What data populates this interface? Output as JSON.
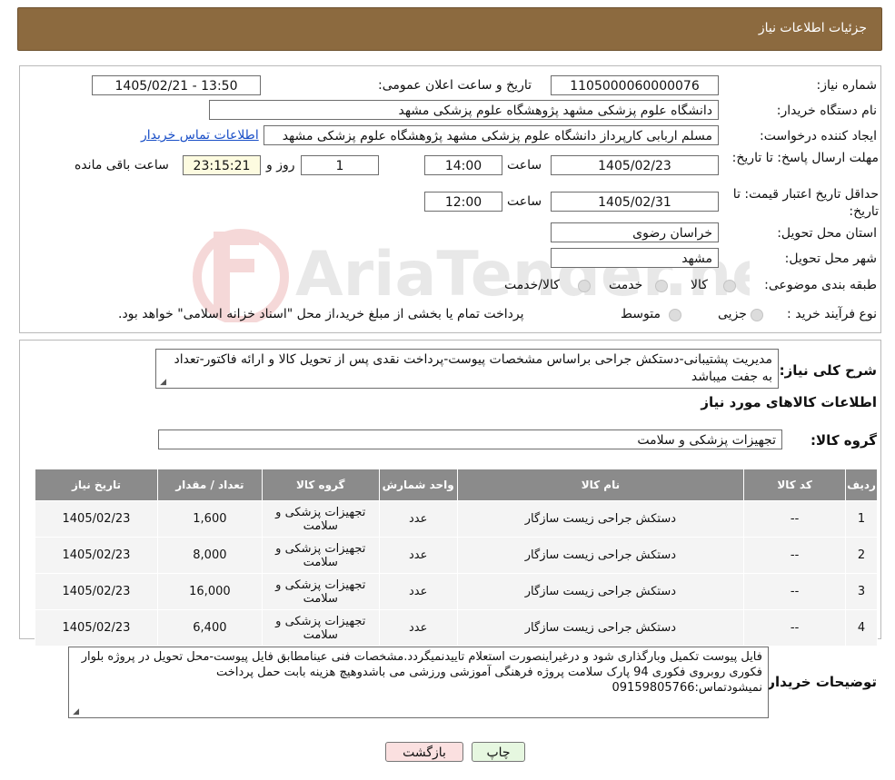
{
  "header": {
    "title": "جزئیات اطلاعات نیاز"
  },
  "form": {
    "need_number_label": "شماره نیاز:",
    "need_number": "1105000060000076",
    "announce_label": "تاریخ و ساعت اعلان عمومی:",
    "announce_value": "1405/02/21 - 13:50",
    "buyer_org_label": "نام دستگاه خریدار:",
    "buyer_org": "دانشگاه علوم پزشکی مشهد   پژوهشگاه علوم پزشکی مشهد",
    "creator_label": "ایجاد کننده درخواست:",
    "creator": "مسلم اربابی کارپرداز دانشگاه علوم پزشکی مشهد   پژوهشگاه علوم پزشکی مشهد",
    "contact_link": "اطلاعات تماس خریدار",
    "deadline_label": "مهلت ارسال پاسخ: تا تاریخ:",
    "deadline_date": "1405/02/23",
    "time_label": "ساعت",
    "deadline_time": "14:00",
    "days_value": "1",
    "days_label": "روز و",
    "remaining_time": "23:15:21",
    "remaining_label": "ساعت باقی مانده",
    "validity_label": "حداقل تاریخ اعتبار قیمت: تا تاریخ:",
    "validity_date": "1405/02/31",
    "validity_time": "12:00",
    "province_label": "استان محل تحویل:",
    "province": "خراسان رضوی",
    "city_label": "شهر محل تحویل:",
    "city": "مشهد",
    "category_label": "طبقه بندی موضوعی:",
    "category_options": [
      "کالا",
      "خدمت",
      "کالا/خدمت"
    ],
    "process_label": "نوع فرآیند خرید :",
    "process_options": [
      "جزیی",
      "متوسط"
    ],
    "process_note": "پرداخت تمام یا بخشی از مبلغ خرید،از محل \"اسناد خزانه اسلامی\" خواهد بود."
  },
  "description": {
    "label": "شرح کلی نیاز:",
    "text": "مدیریت پشتیبانی-دستکش جراحی براساس مشخصات پیوست-پرداخت نقدی پس از تحویل کالا و ارائه فاکتور-تعداد به جفت میباشد"
  },
  "goods_section": {
    "title": "اطلاعات کالاهای مورد نیاز",
    "group_label": "گروه کالا:",
    "group_value": "تجهیزات پزشکی و سلامت"
  },
  "table": {
    "headers": [
      "ردیف",
      "کد کالا",
      "نام کالا",
      "واحد شمارش",
      "گروه کالا",
      "تعداد / مقدار",
      "تاریخ نیاز"
    ],
    "rows": [
      [
        "1",
        "--",
        "دستکش جراحی زیست سازگار",
        "عدد",
        "تجهیزات پزشکی و سلامت",
        "1,600",
        "1405/02/23"
      ],
      [
        "2",
        "--",
        "دستکش جراحی زیست سازگار",
        "عدد",
        "تجهیزات پزشکی و سلامت",
        "8,000",
        "1405/02/23"
      ],
      [
        "3",
        "--",
        "دستکش جراحی زیست سازگار",
        "عدد",
        "تجهیزات پزشکی و سلامت",
        "16,000",
        "1405/02/23"
      ],
      [
        "4",
        "--",
        "دستکش جراحی زیست سازگار",
        "عدد",
        "تجهیزات پزشکی و سلامت",
        "6,400",
        "1405/02/23"
      ]
    ]
  },
  "buyer_notes": {
    "label": "توضیحات خریدار:",
    "text": "فایل پیوست تکمیل وبارگذاری شود و درغیراینصورت استعلام تاییدنمیگردد.مشخصات فنی عینامطابق فایل پیوست-محل تحویل در پروژه بلوار فکوری روبروی فکوری 94 پارک سلامت پروژه فرهنگی آموزشی ورزشی می باشدوهیچ هزینه بابت حمل پرداخت نمیشودتماس:09159805766"
  },
  "buttons": {
    "print": "چاپ",
    "back": "بازگشت"
  },
  "watermark": {
    "text": "AriaTender.neT"
  },
  "colors": {
    "header_bg": "#8c6a3f",
    "table_header": "#8b8b8b",
    "link": "#1a4fc7",
    "back_btn": "#fbe0e0",
    "print_btn": "#e6f7e0"
  }
}
